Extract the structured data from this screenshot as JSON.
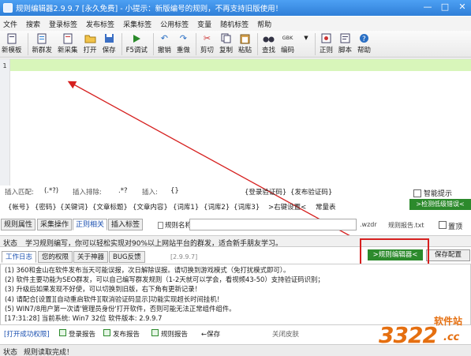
{
  "window": {
    "title": "规则编辑器2.9.9.7 [永久免费] - 小提示：新版编号的规则，不再支持旧版使用！"
  },
  "menu": [
    "文件",
    "搜索",
    "登录标签",
    "发布标签",
    "采集标签",
    "公用标签",
    "变量",
    "随机标签",
    "帮助"
  ],
  "toolbar": [
    {
      "label": "新模板",
      "icon": "new-template-icon"
    },
    {
      "label": "新群发",
      "icon": "new-mass-send-icon"
    },
    {
      "label": "新采集",
      "icon": "new-collect-icon"
    },
    {
      "label": "打开",
      "icon": "open-folder-icon"
    },
    {
      "label": "保存",
      "icon": "save-icon"
    },
    {
      "label": "F5调试",
      "icon": "debug-play-icon"
    },
    {
      "label": "撤销",
      "icon": "undo-icon"
    },
    {
      "label": "重做",
      "icon": "redo-icon"
    },
    {
      "label": "剪切",
      "icon": "scissors-icon"
    },
    {
      "label": "复制",
      "icon": "copy-icon"
    },
    {
      "label": "粘贴",
      "icon": "paste-icon"
    },
    {
      "label": "查找",
      "icon": "binoculars-icon"
    },
    {
      "label": "编码",
      "icon": "encoding-icon",
      "icon_text": "GBK"
    },
    {
      "label": "正则",
      "icon": "regex-icon"
    },
    {
      "label": "脚本",
      "icon": "script-icon"
    },
    {
      "label": "帮助",
      "icon": "help-icon"
    }
  ],
  "editor": {
    "line_number": "1"
  },
  "hints": {
    "match": "插入匹配:",
    "match_val": "(.*?)",
    "exclude": "插入排除:",
    "exclude_val": ".*?",
    "insert": "插入:",
    "insert_val": "{}",
    "login_code": "{登录验证码}",
    "publish_code": "{发布验证码}",
    "smart_tip": "智能提示"
  },
  "labels": [
    "{帐号}",
    "{密码}",
    "{关键词}",
    "{文章标题}",
    "{文章内容}",
    "{词库1}",
    "{词库2}",
    "{词库3}",
    ">右键设置<",
    "常量表"
  ],
  "detect_button": ">检测低级错误<",
  "tabs2": [
    "规则属性",
    "采集操作",
    "正则相关",
    "插入标签"
  ],
  "rule_name_label": "规则名称:",
  "ext_wzdr": ".wzdr",
  "report_file": "规则报告.txt",
  "pin_label": "置顶",
  "status": {
    "label": "状态",
    "text": "学习规则编写，你可以轻松实现对90%以上网站平台的群发，适合新手朋友学习。"
  },
  "log_tabs": [
    "工作日志",
    "您的权限",
    "关于神器",
    "BUG反馈"
  ],
  "version_tag": "[2.9.9.7]",
  "rule_editor_button": ">规则编辑器<",
  "save_config_button": "保存配置",
  "log_lines": [
    "(1) 360和金山在软件发布当天可能误报，次日解除误报。请切换到游戏模式（免打扰模式即可）。",
    "(2) 软件主要功能为SEO群发，可以自己编写群发规则（1-2天就可以学会，看视频43-50）支持验证码识别；",
    "(3) 升级后如果发现不好使，可以切换到旧版，右下角有更新记录！",
    "(4) 请配合[设置][自动重启软件][取消验证码显示]功能实现超长时间挂机！",
    "(5) WIN7/8用户第一次请'管理员身份'打开软件，否则可能无法正常组件组件。",
    "[17:31:28] 当前系统: Win7 32位 软件版本: 2.9.9.7"
  ],
  "options": {
    "open_permission": "[打开成功权限]",
    "login_report": "登录报告",
    "publish_report": "发布报告",
    "rule_report": "规则报告",
    "save": "←保存",
    "close_skin": "关闭皮肤"
  },
  "bottom_status": {
    "label": "状态",
    "text": "规则读取完成！"
  },
  "watermark": {
    "main": "3322",
    "suffix": ".cc",
    "top": "软件站"
  }
}
